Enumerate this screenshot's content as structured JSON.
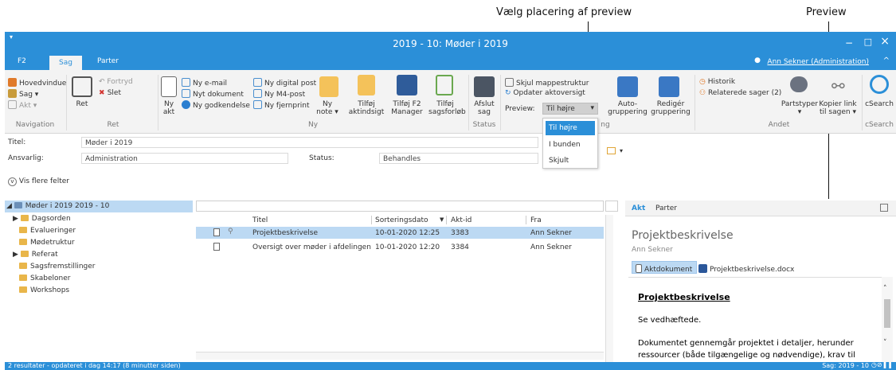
{
  "callouts": {
    "placement": "Vælg placering af preview",
    "preview": "Preview"
  },
  "window": {
    "title": "2019 - 10: Møder i 2019",
    "minimize": "−",
    "maximize": "□",
    "close": "×",
    "collapse": "^",
    "qat": "▾"
  },
  "tabs": [
    {
      "label": "F2"
    },
    {
      "label": "Sag"
    },
    {
      "label": "Parter"
    }
  ],
  "user": "Ann Sekner (Administration)",
  "ribbon": {
    "nav": {
      "hovedvindue": "Hovedvindue",
      "sag": "Sag ▾",
      "akt": "Akt ▾",
      "group": "Navigation"
    },
    "ret": {
      "ret": "Ret",
      "fortryd": "Fortryd",
      "slet": "Slet",
      "group": "Ret"
    },
    "ny": {
      "nyakt": "Ny akt",
      "email": "Ny e-mail",
      "dokument": "Nyt dokument",
      "godkendelse": "Ny godkendelse",
      "digital": "Ny digital post",
      "m4": "Ny M4-post",
      "fjernprint": "Ny fjernprint",
      "note": "Ny note ▾",
      "aktindsigt": "Tilføj aktindsigt",
      "f2manager": "Tilføj F2 Manager",
      "sagsforloeb": "Tilføj sagsforløb",
      "group": "Ny"
    },
    "status": {
      "afslut": "Afslut sag",
      "group": "Status"
    },
    "view": {
      "skjul": "Skjul mappestruktur",
      "opdater": "Opdater aktoversigt",
      "preview_label": "Preview:",
      "preview_value": "Til højre",
      "auto": "Auto-gruppering",
      "rediger": "Redigér gruppering",
      "group_suffix": "ng"
    },
    "andet": {
      "historik": "Historik",
      "relaterede": "Relaterede sager (2)",
      "partstyper": "Partstyper ▾",
      "kopier": "Kopier link til sagen ▾",
      "group": "Andet"
    },
    "csearch": {
      "label": "cSearch",
      "group": "cSearch"
    }
  },
  "dropdown": {
    "options": [
      "Til højre",
      "I bunden",
      "Skjult"
    ]
  },
  "fields": {
    "titel_label": "Titel:",
    "titel_value": "Møder i 2019",
    "ansvarlig_label": "Ansvarlig:",
    "ansvarlig_value": "Administration",
    "status_label": "Status:",
    "status_value": "Behandles",
    "vis_flere": "Vis flere felter"
  },
  "tree": {
    "root": "Møder i 2019 2019 - 10",
    "items": [
      {
        "label": "Dagsorden",
        "expandable": true
      },
      {
        "label": "Evalueringer",
        "expandable": false
      },
      {
        "label": "Mødetruktur",
        "expandable": false
      },
      {
        "label": "Referat",
        "expandable": true
      },
      {
        "label": "Sagsfremstillinger",
        "expandable": false
      },
      {
        "label": "Skabeloner",
        "expandable": false
      },
      {
        "label": "Workshops",
        "expandable": false
      }
    ]
  },
  "list": {
    "columns": {
      "titel": "Titel",
      "sortdato": "Sorteringsdato",
      "aktid": "Akt-id",
      "fra": "Fra"
    },
    "rows": [
      {
        "titel": "Projektbeskrivelse",
        "dato": "10-01-2020 12:25",
        "aktid": "3383",
        "fra": "Ann Sekner"
      },
      {
        "titel": "Oversigt over møder i afdelingen",
        "dato": "10-01-2020 12:20",
        "aktid": "3384",
        "fra": "Ann Sekner"
      }
    ]
  },
  "preview": {
    "tab_akt": "Akt",
    "tab_parter": "Parter",
    "title": "Projektbeskrivelse",
    "author": "Ann Sekner",
    "aktdokument": "Aktdokument",
    "file": "Projektbeskrivelse.docx",
    "doc_heading": "Projektbeskrivelse",
    "doc_p1": "Se vedhæftede.",
    "doc_p2a": "Dokumentet gennemgår projektet i detaljer, herunder",
    "doc_p2b": "ressourcer (både tilgængelige og nødvendige), krav til"
  },
  "status": {
    "left": "2 resultater - opdateret i dag 14:17 (8 minutter siden)",
    "right": "Sag: 2019 - 10"
  },
  "colors": {
    "accent": "#2b8fd8",
    "selection": "#bcd9f3"
  }
}
